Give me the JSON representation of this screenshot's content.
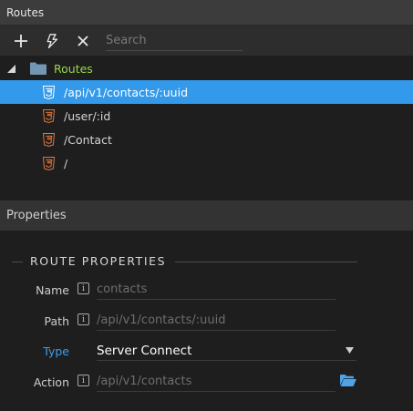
{
  "routes_panel": {
    "title": "Routes",
    "toolbar": {
      "add_icon": "plus-icon",
      "action_icon": "lightning-icon",
      "delete_icon": "close-icon",
      "search_placeholder": "Search"
    },
    "tree": {
      "root_label": "Routes",
      "root_color": "#98d84a",
      "selected_color": "#3399ea",
      "routes": [
        {
          "path": "/api/v1/contacts/:uuid",
          "selected": true
        },
        {
          "path": "/user/:id",
          "selected": false
        },
        {
          "path": "/Contact",
          "selected": false
        },
        {
          "path": "/",
          "selected": false
        }
      ]
    }
  },
  "properties_panel": {
    "title": "Properties",
    "section_title": "ROUTE PROPERTIES",
    "fields": {
      "name": {
        "label": "Name",
        "placeholder": "contacts"
      },
      "path": {
        "label": "Path",
        "placeholder": "/api/v1/contacts/:uuid"
      },
      "type": {
        "label": "Type",
        "value": "Server Connect"
      },
      "action": {
        "label": "Action",
        "placeholder": "/api/v1/contacts"
      }
    },
    "info_glyph": "i",
    "accent_color": "#3d9df2",
    "folder_icon_color": "#4fa3e8"
  }
}
